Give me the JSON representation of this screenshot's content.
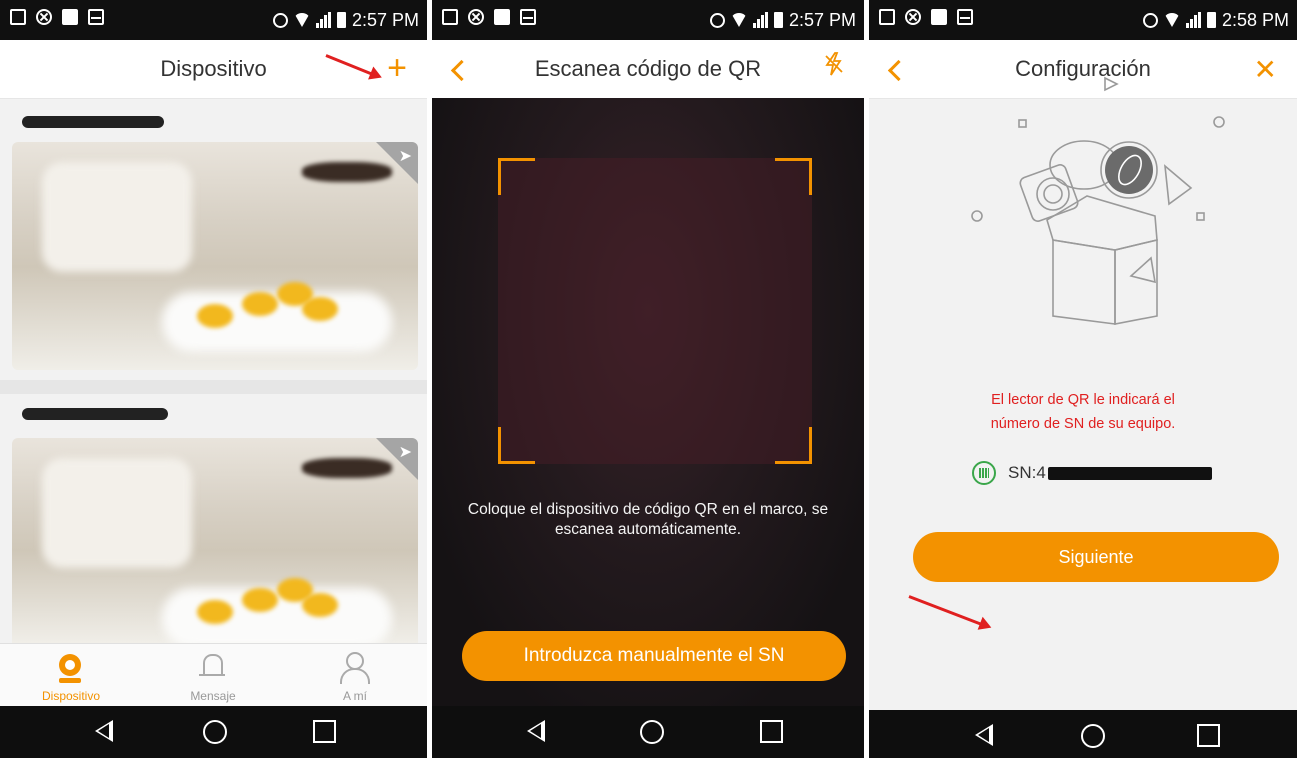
{
  "status": {
    "panel1_time": "2:57 PM",
    "panel2_time": "2:57 PM",
    "panel3_time": "2:58 PM"
  },
  "panel1": {
    "title": "Dispositivo",
    "add_icon": "plus-icon",
    "tabs": [
      {
        "label": "Dispositivo",
        "icon": "camera-icon",
        "active": true
      },
      {
        "label": "Mensaje",
        "icon": "bell-icon",
        "active": false
      },
      {
        "label": "A mí",
        "icon": "user-icon",
        "active": false
      }
    ]
  },
  "panel2": {
    "title": "Escanea código de QR",
    "instruction": "Coloque el dispositivo de código QR en el marco, se escanea automáticamente.",
    "manual_button": "Introduzca manualmente el SN"
  },
  "panel3": {
    "title": "Configuración",
    "hint_line1": "El lector de QR le indicará el",
    "hint_line2": "número de SN de su equipo.",
    "sn_label": "SN:4",
    "next_button": "Siguiente"
  },
  "colors": {
    "accent": "#f39200",
    "hint_text": "#e02020",
    "annotation_arrow": "#e02020",
    "sn_icon": "#3aa64a"
  }
}
